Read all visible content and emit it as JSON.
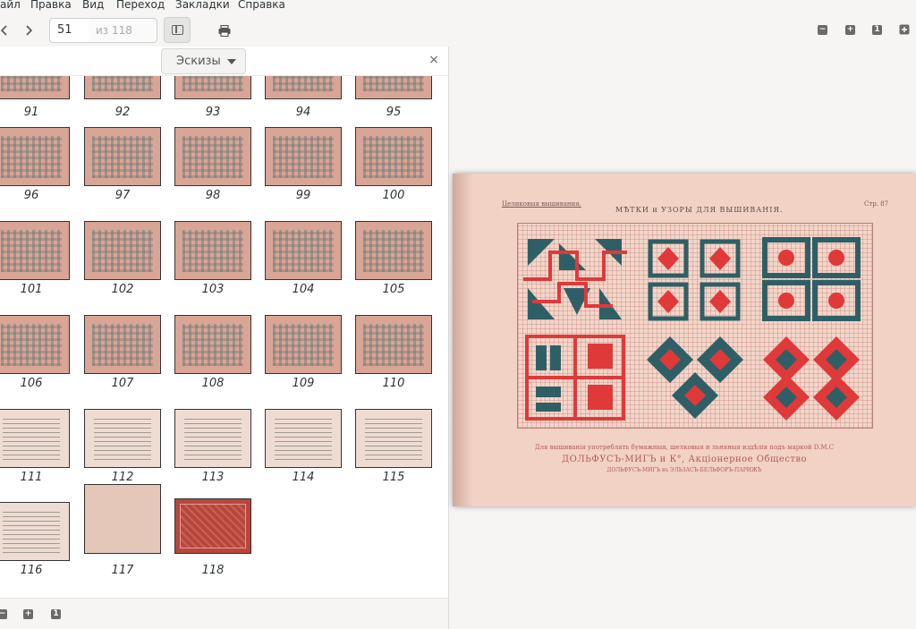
{
  "menu": {
    "items": [
      "айл",
      "Правка",
      "Вид",
      "Переход",
      "Закладки",
      "Справка"
    ]
  },
  "toolbar": {
    "current_page": "51",
    "total_pages": "из 118",
    "zoom_minus": "−",
    "zoom_plus": "+",
    "zoom_one": "1"
  },
  "sidebar": {
    "view_mode": "Эскизы",
    "close": "×",
    "thumbnails": [
      {
        "label": "91",
        "kind": "pattern"
      },
      {
        "label": "92",
        "kind": "pattern"
      },
      {
        "label": "93",
        "kind": "pattern"
      },
      {
        "label": "94",
        "kind": "pattern"
      },
      {
        "label": "95",
        "kind": "pattern"
      },
      {
        "label": "96",
        "kind": "pattern"
      },
      {
        "label": "97",
        "kind": "pattern"
      },
      {
        "label": "98",
        "kind": "pattern"
      },
      {
        "label": "99",
        "kind": "pattern"
      },
      {
        "label": "100",
        "kind": "pattern"
      },
      {
        "label": "101",
        "kind": "pattern"
      },
      {
        "label": "102",
        "kind": "pattern"
      },
      {
        "label": "103",
        "kind": "pattern"
      },
      {
        "label": "104",
        "kind": "pattern"
      },
      {
        "label": "105",
        "kind": "pattern"
      },
      {
        "label": "106",
        "kind": "pattern"
      },
      {
        "label": "107",
        "kind": "pattern"
      },
      {
        "label": "108",
        "kind": "pattern"
      },
      {
        "label": "109",
        "kind": "pattern"
      },
      {
        "label": "110",
        "kind": "pattern"
      },
      {
        "label": "111",
        "kind": "text"
      },
      {
        "label": "112",
        "kind": "text"
      },
      {
        "label": "113",
        "kind": "text"
      },
      {
        "label": "114",
        "kind": "text"
      },
      {
        "label": "115",
        "kind": "text"
      },
      {
        "label": "116",
        "kind": "text"
      },
      {
        "label": "117",
        "kind": "cover"
      },
      {
        "label": "118",
        "kind": "red"
      }
    ],
    "footer_minus": "−",
    "footer_plus": "+",
    "footer_one": "1"
  },
  "page_view": {
    "header_left": "Целиковыя вышивания.",
    "title": "МѢТКИ и УЗОРЫ ДЛЯ ВЫШИВАНІЯ.",
    "page_no": "Стр. 87",
    "caption1": "Для вышиванія употреблять бумажныя, шелковыя и льняныя издѣлія подъ маркой D.M.C",
    "caption2": "ДОЛЬФУСЪ-МИГЪ и К°, Акціонерное Общество",
    "caption3": "ДОЛЬФУСЪ-МИГЪ въ ЭЛЬЗАСЪ-БЕЛЬФОРЪ-ПАРИЖЪ",
    "colors": {
      "red": "#e0393a",
      "teal": "#2f5f66"
    }
  }
}
